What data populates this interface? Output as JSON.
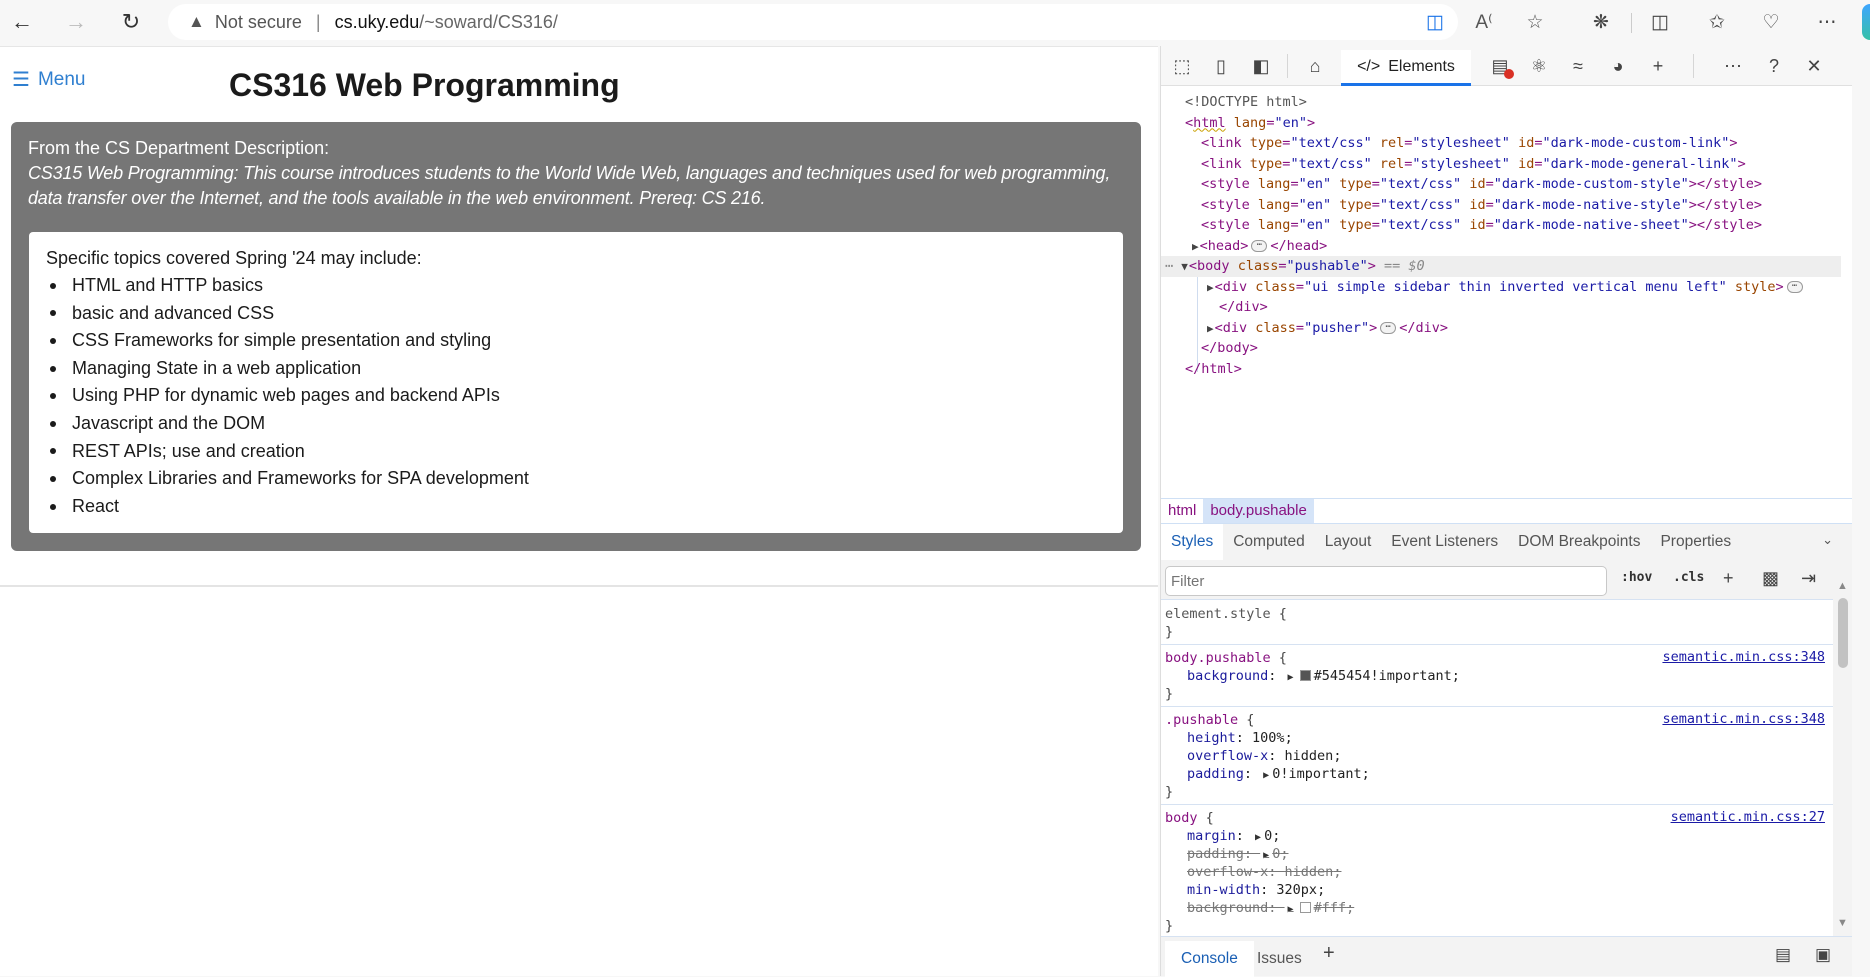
{
  "browser": {
    "security_label": "Not secure",
    "url_host": "cs.uky.edu",
    "url_path": "/~soward/CS316/",
    "icons": [
      "back-icon",
      "forward-icon",
      "refresh-icon",
      "warning-icon",
      "browser-essentials-icon",
      "read-aloud-icon",
      "favorite-star-icon",
      "extensions-icon",
      "split-screen-icon",
      "favorites-icon",
      "browser-health-icon",
      "more-icon"
    ]
  },
  "page": {
    "menu_label": "Menu",
    "title": "CS316 Web Programming",
    "description_intro": "From the CS Department Description:",
    "description_text": "CS315 Web Programming: This course introduces students to the World Wide Web, languages and techniques used for web programming, data transfer over the Internet, and the tools available in the web environment. Prereq: CS 216.",
    "topics_heading": "Specific topics covered Spring '24 may include:",
    "topics": [
      "HTML and HTTP basics",
      "basic and advanced CSS",
      "CSS Frameworks for simple presentation and styling",
      "Managing State in a web application",
      "Using PHP for dynamic web pages and backend APIs",
      "Javascript and the DOM",
      "REST APIs; use and creation",
      "Complex Libraries and Frameworks for SPA development",
      "React"
    ],
    "colors": {
      "description_bg": "#767676",
      "menu_link": "#2f7fd0"
    }
  },
  "devtools": {
    "active_tab": "Elements",
    "dom": {
      "doctype": "<!DOCTYPE html>",
      "html_tag": "html",
      "html_attr": "lang",
      "html_val": "\"en\"",
      "links": [
        {
          "tag": "link",
          "attrs": [
            [
              "type",
              "\"text/css\""
            ],
            [
              "rel",
              "\"stylesheet\""
            ],
            [
              "id",
              "\"dark-mode-custom-link\""
            ]
          ],
          "close": ">"
        },
        {
          "tag": "link",
          "attrs": [
            [
              "type",
              "\"text/css\""
            ],
            [
              "rel",
              "\"stylesheet\""
            ],
            [
              "id",
              "\"dark-mode-general-link\""
            ]
          ],
          "close": ">"
        },
        {
          "tag": "style",
          "attrs": [
            [
              "lang",
              "\"en\""
            ],
            [
              "type",
              "\"text/css\""
            ],
            [
              "id",
              "\"dark-mode-custom-style\""
            ]
          ],
          "close": "></style>"
        },
        {
          "tag": "style",
          "attrs": [
            [
              "lang",
              "\"en\""
            ],
            [
              "type",
              "\"text/css\""
            ],
            [
              "id",
              "\"dark-mode-native-style\""
            ]
          ],
          "close": "></style>"
        },
        {
          "tag": "style",
          "attrs": [
            [
              "lang",
              "\"en\""
            ],
            [
              "type",
              "\"text/css\""
            ],
            [
              "id",
              "\"dark-mode-native-sheet\""
            ]
          ],
          "close": "></style>"
        }
      ],
      "head_open": "<head>",
      "head_close": "</head>",
      "body_open": "<body",
      "body_class_attr": "class",
      "body_class_val": "\"pushable\"",
      "selected_marker": "== $0",
      "sidebar_div_open": "<div",
      "sidebar_div_class": "\"ui simple sidebar thin inverted vertical menu left\"",
      "sidebar_div_style_attr": "style",
      "div_close": "</div>",
      "pusher_class": "\"pusher\"",
      "body_close": "</body>",
      "html_close": "</html>"
    },
    "breadcrumbs": [
      "html",
      "body.pushable"
    ],
    "styles_tabs": [
      "Styles",
      "Computed",
      "Layout",
      "Event Listeners",
      "DOM Breakpoints",
      "Properties"
    ],
    "filter_placeholder": "Filter",
    "filter_buttons": [
      ":hov",
      ".cls"
    ],
    "rules": [
      {
        "selector": "element.style",
        "source": "",
        "props": []
      },
      {
        "selector": "body.pushable",
        "source": "semantic.min.css:348",
        "props": [
          {
            "name": "background",
            "value": "#545454!important",
            "swatch": "#545454",
            "expandable": true,
            "struck": false
          }
        ]
      },
      {
        "selector": ".pushable",
        "source": "semantic.min.css:348",
        "props": [
          {
            "name": "height",
            "value": "100%",
            "struck": false
          },
          {
            "name": "overflow-x",
            "value": "hidden",
            "struck": false
          },
          {
            "name": "padding",
            "value": "0!important",
            "expandable": true,
            "struck": false
          }
        ]
      },
      {
        "selector": "body",
        "source": "semantic.min.css:27",
        "props": [
          {
            "name": "margin",
            "value": "0",
            "expandable": true,
            "struck": false
          },
          {
            "name": "padding",
            "value": "0",
            "expandable": true,
            "struck": true
          },
          {
            "name": "overflow-x",
            "value": "hidden",
            "struck": true
          },
          {
            "name": "min-width",
            "value": "320px",
            "struck": false
          },
          {
            "name": "background",
            "value": "#fff",
            "swatch": "#ffffff",
            "expandable": true,
            "struck": true
          }
        ]
      }
    ],
    "drawer_tabs": [
      "Console",
      "Issues"
    ]
  }
}
